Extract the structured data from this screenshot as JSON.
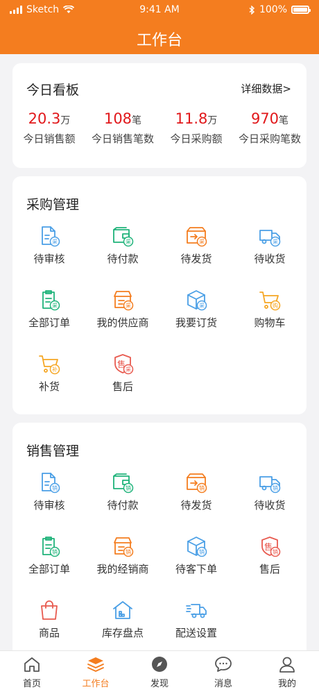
{
  "status_bar": {
    "carrier": "Sketch",
    "time": "9:41 AM",
    "battery": "100%"
  },
  "header": {
    "title": "工作台"
  },
  "dashboard": {
    "title": "今日看板",
    "detail_link": "详细数据>",
    "stats": [
      {
        "value": "20.3",
        "unit": "万",
        "label": "今日销售额"
      },
      {
        "value": "108",
        "unit": "笔",
        "label": "今日销售笔数"
      },
      {
        "value": "11.8",
        "unit": "万",
        "label": "今日采购额"
      },
      {
        "value": "970",
        "unit": "笔",
        "label": "今日采购笔数"
      }
    ]
  },
  "purchase": {
    "title": "采购管理",
    "items": [
      {
        "label": "待审核",
        "icon": "document-icon",
        "badge": "采",
        "color": "#4a9fe6"
      },
      {
        "label": "待付款",
        "icon": "wallet-icon",
        "badge": "采",
        "color": "#1fb37a"
      },
      {
        "label": "待发货",
        "icon": "box-outgoing-icon",
        "badge": "采",
        "color": "#f47d1f"
      },
      {
        "label": "待收货",
        "icon": "truck-icon",
        "badge": "采",
        "color": "#4a9fe6"
      },
      {
        "label": "全部订单",
        "icon": "clipboard-icon",
        "badge": "采",
        "color": "#1fb37a"
      },
      {
        "label": "我的供应商",
        "icon": "store-icon",
        "badge": "采",
        "color": "#f47d1f"
      },
      {
        "label": "我要订货",
        "icon": "package-icon",
        "badge": "采",
        "color": "#4a9fe6"
      },
      {
        "label": "购物车",
        "icon": "cart-icon",
        "badge": "购",
        "color": "#f5a623"
      },
      {
        "label": "补货",
        "icon": "cart-icon",
        "badge": "补",
        "color": "#f5a623"
      },
      {
        "label": "售后",
        "icon": "shield-icon",
        "badge": "采",
        "color": "#e85a4f"
      }
    ]
  },
  "sales": {
    "title": "销售管理",
    "items": [
      {
        "label": "待审核",
        "icon": "document-icon",
        "badge": "销",
        "color": "#4a9fe6"
      },
      {
        "label": "待付款",
        "icon": "wallet-icon",
        "badge": "销",
        "color": "#1fb37a"
      },
      {
        "label": "待发货",
        "icon": "box-outgoing-icon",
        "badge": "销",
        "color": "#f47d1f"
      },
      {
        "label": "待收货",
        "icon": "truck-icon",
        "badge": "销",
        "color": "#4a9fe6"
      },
      {
        "label": "全部订单",
        "icon": "clipboard-icon",
        "badge": "销",
        "color": "#1fb37a"
      },
      {
        "label": "我的经销商",
        "icon": "store-icon",
        "badge": "销",
        "color": "#f47d1f"
      },
      {
        "label": "待客下单",
        "icon": "package-icon",
        "badge": "销",
        "color": "#4a9fe6"
      },
      {
        "label": "售后",
        "icon": "shield-icon",
        "badge": "销",
        "color": "#e85a4f"
      },
      {
        "label": "商品",
        "icon": "shopping-bag-icon",
        "badge": "",
        "color": "#e85a4f"
      },
      {
        "label": "库存盘点",
        "icon": "warehouse-icon",
        "badge": "",
        "color": "#4a9fe6"
      },
      {
        "label": "配送设置",
        "icon": "delivery-truck-icon",
        "badge": "",
        "color": "#4a9fe6"
      }
    ]
  },
  "tabbar": {
    "active_color": "#f47d1f",
    "items": [
      {
        "label": "首页",
        "icon": "home-icon"
      },
      {
        "label": "工作台",
        "icon": "layers-icon"
      },
      {
        "label": "发现",
        "icon": "compass-icon"
      },
      {
        "label": "消息",
        "icon": "chat-icon"
      },
      {
        "label": "我的",
        "icon": "user-icon"
      }
    ]
  }
}
